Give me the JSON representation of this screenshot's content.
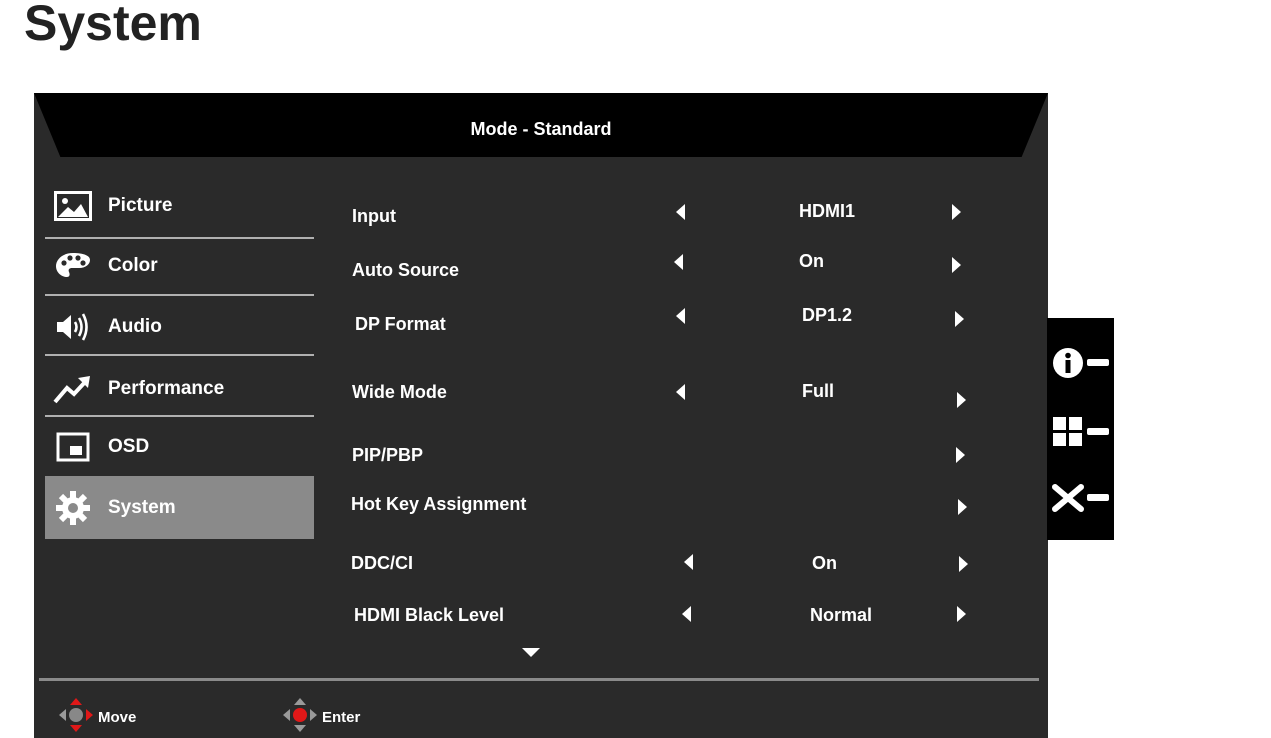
{
  "page_heading": "System",
  "osd": {
    "title": "Mode - Standard",
    "menu": [
      {
        "label": "Picture",
        "icon": "picture-icon"
      },
      {
        "label": "Color",
        "icon": "palette-icon"
      },
      {
        "label": "Audio",
        "icon": "speaker-icon"
      },
      {
        "label": "Performance",
        "icon": "trend-up-icon"
      },
      {
        "label": "OSD",
        "icon": "osd-window-icon"
      },
      {
        "label": "System",
        "icon": "gear-icon",
        "active": true
      }
    ],
    "rows": [
      {
        "label": "Input",
        "value": "HDMI1"
      },
      {
        "label": "Auto Source",
        "value": "On"
      },
      {
        "label": "DP Format",
        "value": "DP1.2"
      },
      {
        "label": "Wide Mode",
        "value": "Full"
      },
      {
        "label": "PIP/PBP",
        "value": ""
      },
      {
        "label": "Hot Key Assignment",
        "value": ""
      },
      {
        "label": "DDC/CI",
        "value": "On"
      },
      {
        "label": "HDMI Black Level",
        "value": "Normal"
      }
    ],
    "footer": {
      "move": "Move",
      "enter": "Enter"
    }
  },
  "hotkeys": [
    {
      "icon": "info-icon"
    },
    {
      "icon": "grid-icon"
    },
    {
      "icon": "close-icon"
    }
  ],
  "colors": {
    "osd_bg": "#2a2a2a",
    "header_bg": "#000000",
    "active_item": "#8a8a8a",
    "nav_red": "#e01818"
  }
}
